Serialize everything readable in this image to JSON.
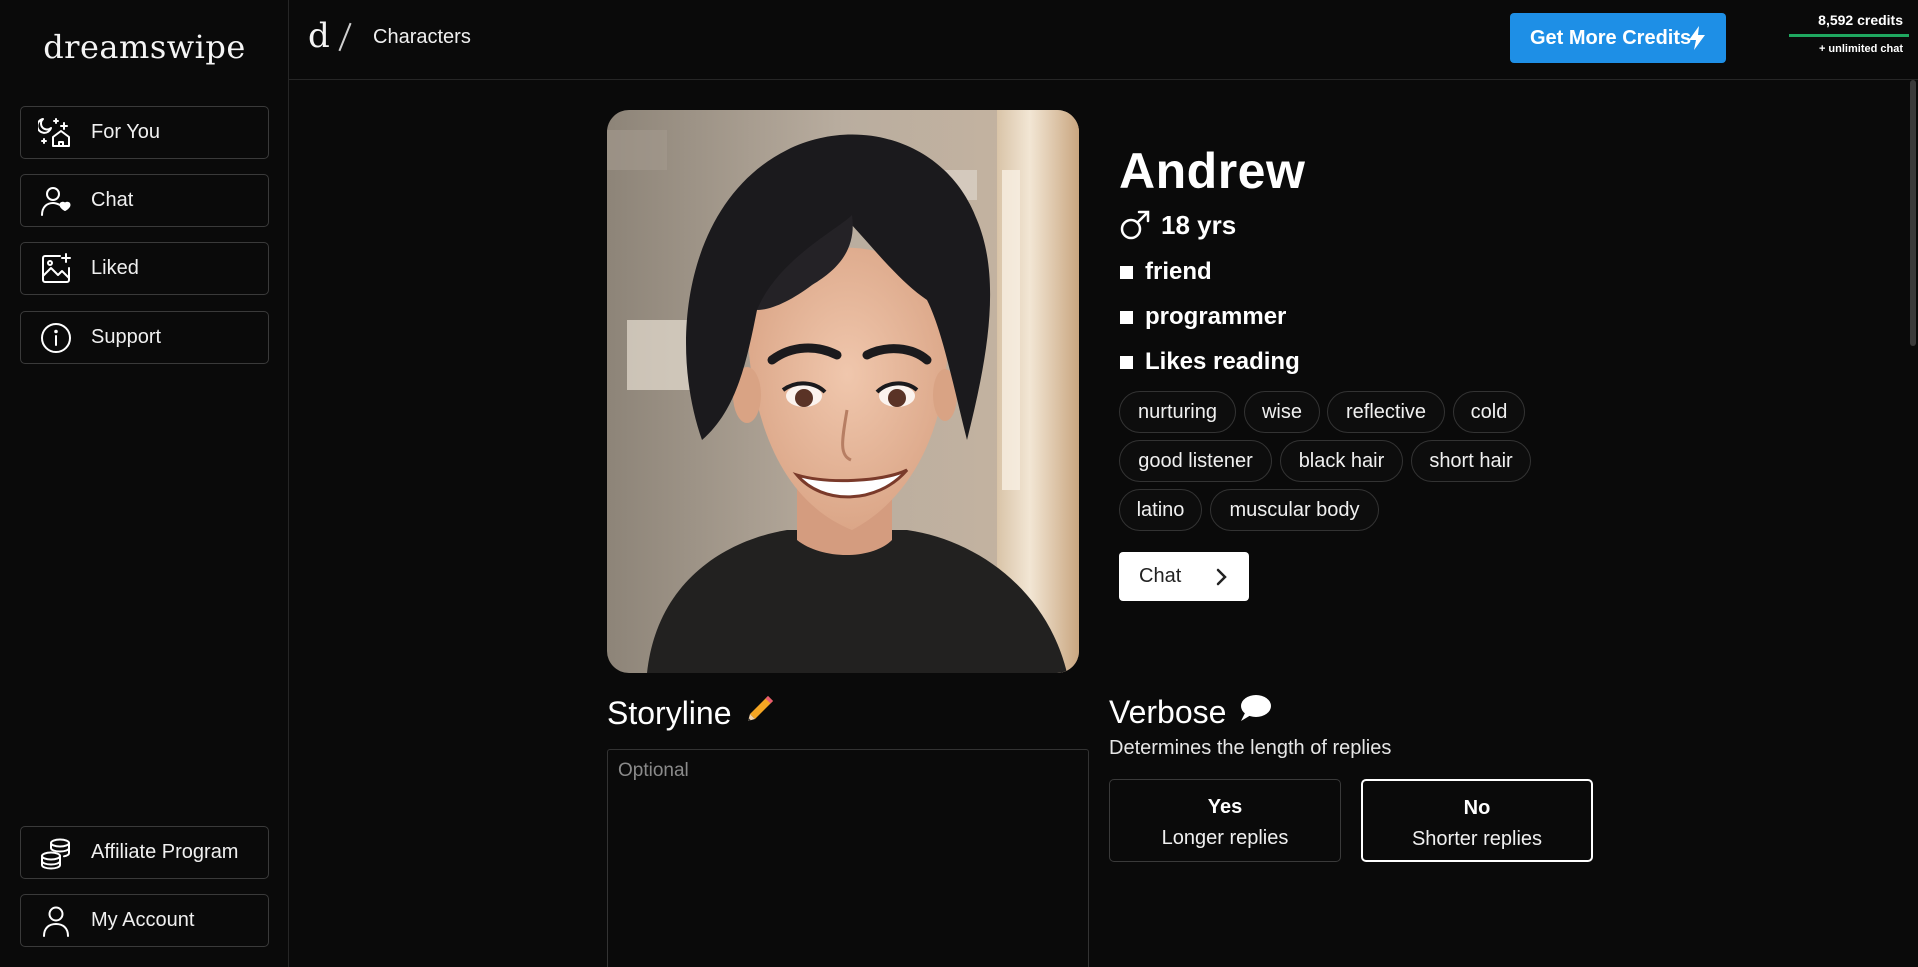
{
  "sidebar": {
    "logo": "dreamswipe",
    "items": [
      {
        "label": "For You",
        "icon": "sparkle-home-icon"
      },
      {
        "label": "Chat",
        "icon": "user-heart-icon"
      },
      {
        "label": "Liked",
        "icon": "image-sparkle-icon"
      },
      {
        "label": "Support",
        "icon": "info-icon"
      }
    ],
    "bottom_items": [
      {
        "label": "Affiliate Program",
        "icon": "coins-icon"
      },
      {
        "label": "My Account",
        "icon": "user-icon"
      }
    ]
  },
  "header": {
    "breadcrumb_root": "d",
    "breadcrumb_page": "Characters",
    "cta_label": "Get More Credits",
    "credits": "8,592 credits",
    "credits_note": "+ unlimited chat"
  },
  "profile": {
    "name": "Andrew",
    "age": "18 yrs",
    "facts": [
      "friend",
      "programmer",
      "Likes reading"
    ],
    "tags": [
      "nurturing",
      "wise",
      "reflective",
      "cold",
      "good listener",
      "black hair",
      "short hair",
      "latino",
      "muscular body"
    ],
    "chat_label": "Chat"
  },
  "storyline": {
    "title": "Storyline",
    "emoji": "✏️",
    "placeholder": "Optional"
  },
  "verbose": {
    "title": "Verbose",
    "emoji": "💬",
    "subtitle": "Determines the length of replies",
    "options": [
      {
        "title": "Yes",
        "desc": "Longer replies",
        "selected": false
      },
      {
        "title": "No",
        "desc": "Shorter replies",
        "selected": true
      }
    ]
  },
  "colors": {
    "background": "#0a0a0a",
    "accent": "#1e8fe6",
    "credit_bar": "#1fa860"
  }
}
